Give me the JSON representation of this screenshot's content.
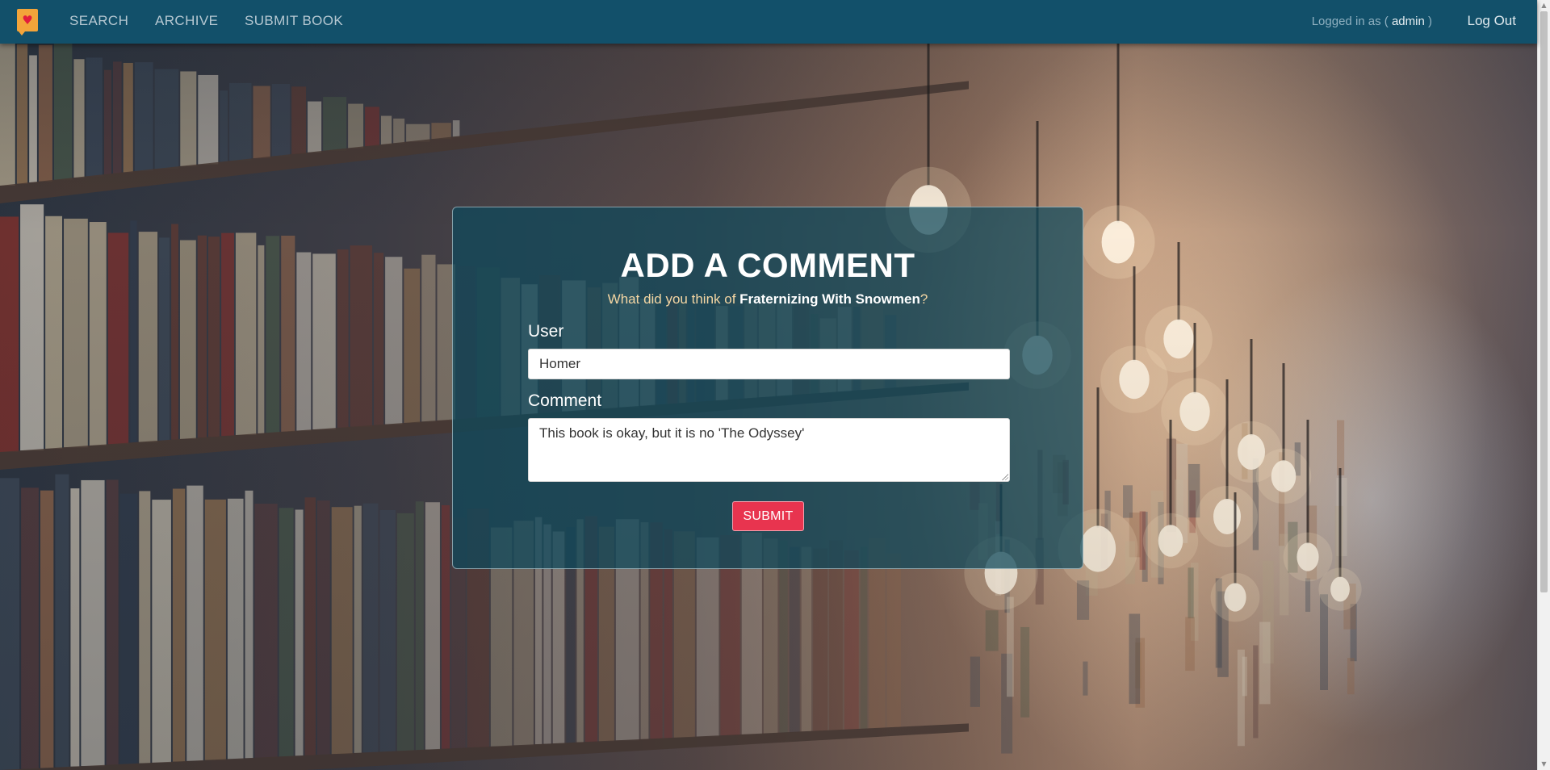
{
  "navbar": {
    "logo_icon": "heart-book-icon",
    "links": [
      {
        "label": "SEARCH"
      },
      {
        "label": "ARCHIVE"
      },
      {
        "label": "SUBMIT BOOK"
      }
    ],
    "login_prefix": "Logged in as (",
    "login_user": "admin",
    "login_suffix": ")",
    "logout_label": "Log Out"
  },
  "form": {
    "title": "ADD A COMMENT",
    "subtitle_prefix": "What did you think of",
    "book_title": "Fraternizing With Snowmen",
    "subtitle_suffix": "?",
    "user_label": "User",
    "user_value": "Homer",
    "comment_label": "Comment",
    "comment_value": "This book is okay, but it is no 'The Odyssey'",
    "submit_label": "SUBMIT"
  },
  "colors": {
    "navbar": "#12506a",
    "submit": "#e8344f",
    "logo": "#f3a43a",
    "subtitle": "#f4d6a3"
  }
}
